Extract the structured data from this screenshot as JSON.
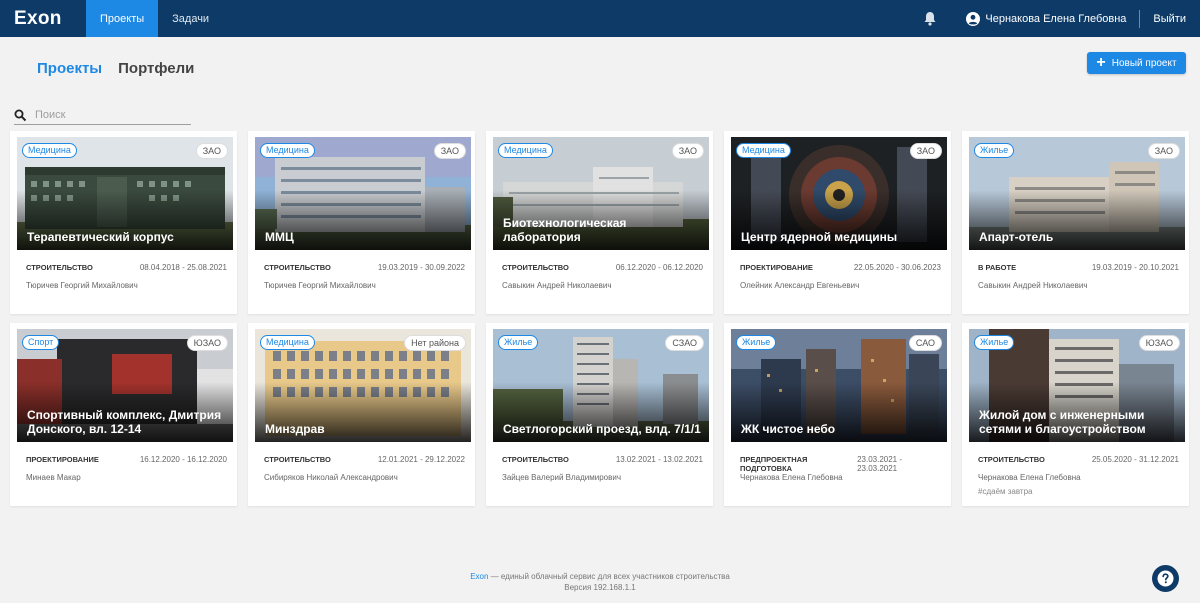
{
  "nav": {
    "logo": "Exon",
    "tabs": [
      "Проекты",
      "Задачи"
    ],
    "user_name": "Чернакова Елена Глебовна",
    "logout": "Выйти"
  },
  "header": {
    "tabs": [
      "Проекты",
      "Портфели"
    ],
    "new_button": "Новый проект"
  },
  "search": {
    "placeholder": "Поиск"
  },
  "cards": [
    {
      "tag": "Медицина",
      "district": "ЗАО",
      "title": "Терапевтический корпус",
      "stage": "СТРОИТЕЛЬСТВО",
      "dates": "08.04.2018 - 25.08.2021",
      "person": "Тюричев Георгий Михайлович",
      "note": ""
    },
    {
      "tag": "Медицина",
      "district": "ЗАО",
      "title": "ММЦ",
      "stage": "СТРОИТЕЛЬСТВО",
      "dates": "19.03.2019 - 30.09.2022",
      "person": "Тюричев Георгий Михайлович",
      "note": ""
    },
    {
      "tag": "Медицина",
      "district": "ЗАО",
      "title": "Биотехнологическая лаборатория",
      "stage": "СТРОИТЕЛЬСТВО",
      "dates": "06.12.2020 - 06.12.2020",
      "person": "Савыкин Андрей Николаевич",
      "note": ""
    },
    {
      "tag": "Медицина",
      "district": "ЗАО",
      "title": "Центр ядерной медицины",
      "stage": "ПРОЕКТИРОВАНИЕ",
      "dates": "22.05.2020 - 30.06.2023",
      "person": "Олейник Александр Евгеньевич",
      "note": ""
    },
    {
      "tag": "Жилье",
      "district": "ЗАО",
      "title": "Апарт-отель",
      "stage": "В РАБОТЕ",
      "dates": "19.03.2019 - 20.10.2021",
      "person": "Савыкин Андрей Николаевич",
      "note": ""
    },
    {
      "tag": "Спорт",
      "district": "ЮЗАО",
      "title": "Спортивный комплекс, Дмитрия Донского, вл. 12-14",
      "stage": "ПРОЕКТИРОВАНИЕ",
      "dates": "16.12.2020 - 16.12.2020",
      "person": "Минаев Макар",
      "note": ""
    },
    {
      "tag": "Медицина",
      "district": "Нет района",
      "title": "Минздрав",
      "stage": "СТРОИТЕЛЬСТВО",
      "dates": "12.01.2021 - 29.12.2022",
      "person": "Сибиряков Николай Александрович",
      "note": ""
    },
    {
      "tag": "Жилье",
      "district": "СЗАО",
      "title": "Светлогорский проезд, влд. 7/1/1",
      "stage": "СТРОИТЕЛЬСТВО",
      "dates": "13.02.2021 - 13.02.2021",
      "person": "Зайцев Валерий Владимирович",
      "note": ""
    },
    {
      "tag": "Жилье",
      "district": "САО",
      "title": "ЖК чистое небо",
      "stage": "ПРЕДПРОЕКТНАЯ ПОДГОТОВКА",
      "dates": "23.03.2021 - 23.03.2021",
      "person": "Чернакова Елена Глебовна",
      "note": ""
    },
    {
      "tag": "Жилье",
      "district": "ЮЗАО",
      "title": "Жилой дом с инженерными сетями и благоустройством",
      "stage": "СТРОИТЕЛЬСТВО",
      "dates": "25.05.2020 - 31.12.2021",
      "person": "Чернакова Елена Глебовна",
      "note": "#сдаём завтра"
    }
  ],
  "footer": {
    "brand": "Exon",
    "tagline": " — единый облачный сервис для всех участников строительства",
    "version": "Версия 192.168.1.1"
  },
  "colors": {
    "nav_bg": "#0d3a66",
    "accent": "#1e88e5",
    "page_bg": "#f2f2f2"
  }
}
